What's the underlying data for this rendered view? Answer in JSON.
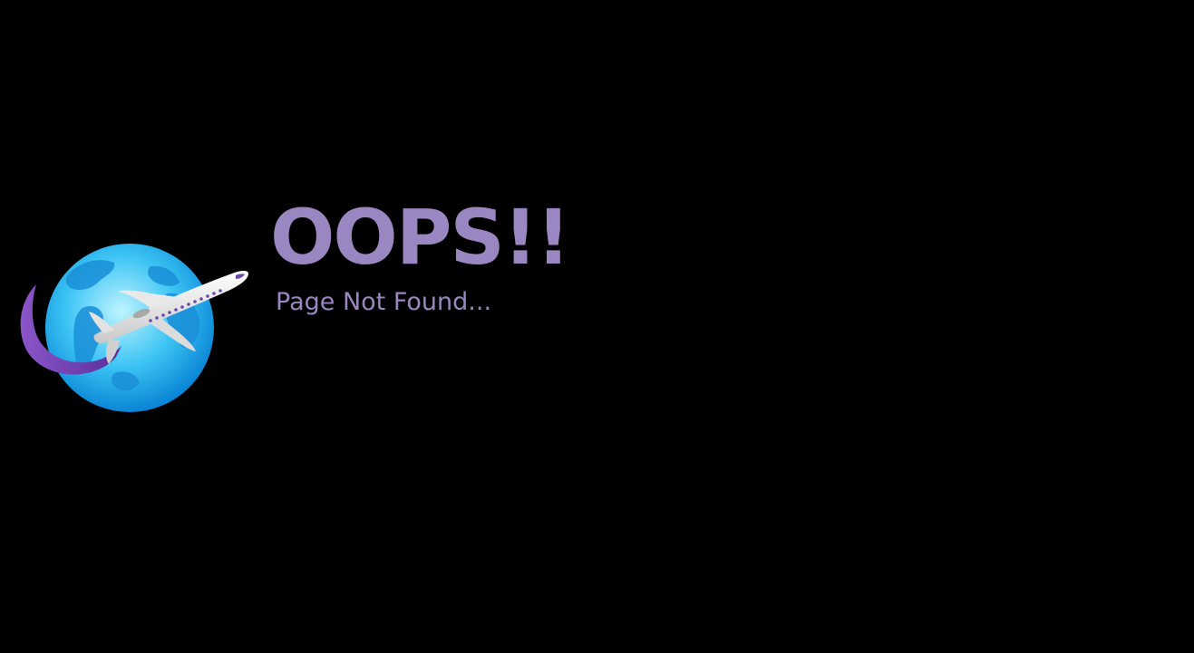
{
  "page": {
    "headline": "OOPS!!",
    "message": "Page Not Found..."
  },
  "logo": {
    "icon": "globe-airplane-icon"
  },
  "colors": {
    "background": "#000000",
    "text": "#9a86c0",
    "globe_light": "#8fe6ff",
    "globe_dark": "#0a86d6",
    "land": "#1a8fd8",
    "swoosh": "#6f3fb0"
  }
}
